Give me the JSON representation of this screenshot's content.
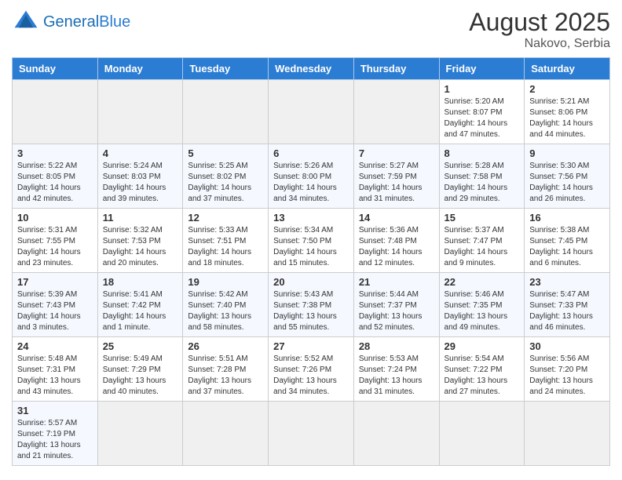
{
  "header": {
    "logo_general": "General",
    "logo_blue": "Blue",
    "title": "August 2025",
    "subtitle": "Nakovo, Serbia"
  },
  "days_of_week": [
    "Sunday",
    "Monday",
    "Tuesday",
    "Wednesday",
    "Thursday",
    "Friday",
    "Saturday"
  ],
  "weeks": [
    [
      {
        "day": "",
        "info": ""
      },
      {
        "day": "",
        "info": ""
      },
      {
        "day": "",
        "info": ""
      },
      {
        "day": "",
        "info": ""
      },
      {
        "day": "",
        "info": ""
      },
      {
        "day": "1",
        "info": "Sunrise: 5:20 AM\nSunset: 8:07 PM\nDaylight: 14 hours and 47 minutes."
      },
      {
        "day": "2",
        "info": "Sunrise: 5:21 AM\nSunset: 8:06 PM\nDaylight: 14 hours and 44 minutes."
      }
    ],
    [
      {
        "day": "3",
        "info": "Sunrise: 5:22 AM\nSunset: 8:05 PM\nDaylight: 14 hours and 42 minutes."
      },
      {
        "day": "4",
        "info": "Sunrise: 5:24 AM\nSunset: 8:03 PM\nDaylight: 14 hours and 39 minutes."
      },
      {
        "day": "5",
        "info": "Sunrise: 5:25 AM\nSunset: 8:02 PM\nDaylight: 14 hours and 37 minutes."
      },
      {
        "day": "6",
        "info": "Sunrise: 5:26 AM\nSunset: 8:00 PM\nDaylight: 14 hours and 34 minutes."
      },
      {
        "day": "7",
        "info": "Sunrise: 5:27 AM\nSunset: 7:59 PM\nDaylight: 14 hours and 31 minutes."
      },
      {
        "day": "8",
        "info": "Sunrise: 5:28 AM\nSunset: 7:58 PM\nDaylight: 14 hours and 29 minutes."
      },
      {
        "day": "9",
        "info": "Sunrise: 5:30 AM\nSunset: 7:56 PM\nDaylight: 14 hours and 26 minutes."
      }
    ],
    [
      {
        "day": "10",
        "info": "Sunrise: 5:31 AM\nSunset: 7:55 PM\nDaylight: 14 hours and 23 minutes."
      },
      {
        "day": "11",
        "info": "Sunrise: 5:32 AM\nSunset: 7:53 PM\nDaylight: 14 hours and 20 minutes."
      },
      {
        "day": "12",
        "info": "Sunrise: 5:33 AM\nSunset: 7:51 PM\nDaylight: 14 hours and 18 minutes."
      },
      {
        "day": "13",
        "info": "Sunrise: 5:34 AM\nSunset: 7:50 PM\nDaylight: 14 hours and 15 minutes."
      },
      {
        "day": "14",
        "info": "Sunrise: 5:36 AM\nSunset: 7:48 PM\nDaylight: 14 hours and 12 minutes."
      },
      {
        "day": "15",
        "info": "Sunrise: 5:37 AM\nSunset: 7:47 PM\nDaylight: 14 hours and 9 minutes."
      },
      {
        "day": "16",
        "info": "Sunrise: 5:38 AM\nSunset: 7:45 PM\nDaylight: 14 hours and 6 minutes."
      }
    ],
    [
      {
        "day": "17",
        "info": "Sunrise: 5:39 AM\nSunset: 7:43 PM\nDaylight: 14 hours and 3 minutes."
      },
      {
        "day": "18",
        "info": "Sunrise: 5:41 AM\nSunset: 7:42 PM\nDaylight: 14 hours and 1 minute."
      },
      {
        "day": "19",
        "info": "Sunrise: 5:42 AM\nSunset: 7:40 PM\nDaylight: 13 hours and 58 minutes."
      },
      {
        "day": "20",
        "info": "Sunrise: 5:43 AM\nSunset: 7:38 PM\nDaylight: 13 hours and 55 minutes."
      },
      {
        "day": "21",
        "info": "Sunrise: 5:44 AM\nSunset: 7:37 PM\nDaylight: 13 hours and 52 minutes."
      },
      {
        "day": "22",
        "info": "Sunrise: 5:46 AM\nSunset: 7:35 PM\nDaylight: 13 hours and 49 minutes."
      },
      {
        "day": "23",
        "info": "Sunrise: 5:47 AM\nSunset: 7:33 PM\nDaylight: 13 hours and 46 minutes."
      }
    ],
    [
      {
        "day": "24",
        "info": "Sunrise: 5:48 AM\nSunset: 7:31 PM\nDaylight: 13 hours and 43 minutes."
      },
      {
        "day": "25",
        "info": "Sunrise: 5:49 AM\nSunset: 7:29 PM\nDaylight: 13 hours and 40 minutes."
      },
      {
        "day": "26",
        "info": "Sunrise: 5:51 AM\nSunset: 7:28 PM\nDaylight: 13 hours and 37 minutes."
      },
      {
        "day": "27",
        "info": "Sunrise: 5:52 AM\nSunset: 7:26 PM\nDaylight: 13 hours and 34 minutes."
      },
      {
        "day": "28",
        "info": "Sunrise: 5:53 AM\nSunset: 7:24 PM\nDaylight: 13 hours and 31 minutes."
      },
      {
        "day": "29",
        "info": "Sunrise: 5:54 AM\nSunset: 7:22 PM\nDaylight: 13 hours and 27 minutes."
      },
      {
        "day": "30",
        "info": "Sunrise: 5:56 AM\nSunset: 7:20 PM\nDaylight: 13 hours and 24 minutes."
      }
    ],
    [
      {
        "day": "31",
        "info": "Sunrise: 5:57 AM\nSunset: 7:19 PM\nDaylight: 13 hours and 21 minutes."
      },
      {
        "day": "",
        "info": ""
      },
      {
        "day": "",
        "info": ""
      },
      {
        "day": "",
        "info": ""
      },
      {
        "day": "",
        "info": ""
      },
      {
        "day": "",
        "info": ""
      },
      {
        "day": "",
        "info": ""
      }
    ]
  ]
}
